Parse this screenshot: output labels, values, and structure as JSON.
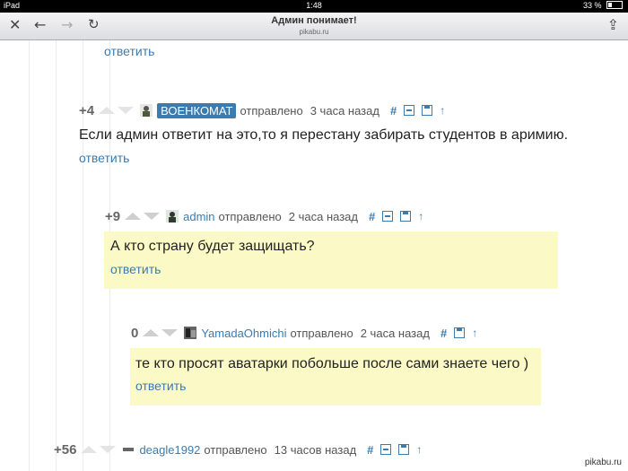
{
  "status": {
    "device": "iPad",
    "time": "1:48",
    "battery": "33 %"
  },
  "browser": {
    "title": "Админ понимает!",
    "url": "pikabu.ru"
  },
  "reply_label": "ответить",
  "comments": [
    {
      "score": "+4",
      "user": "ВОЕНКОМАТ",
      "sent": "отправлено",
      "when": "3 часа назад",
      "text": "Если админ ответит на это,то я перестану забирать студентов в аримию."
    },
    {
      "score": "+9",
      "user": "admin",
      "sent": "отправлено",
      "when": "2 часа назад",
      "text": "А кто страну будет защищать?"
    },
    {
      "score": "0",
      "user": "YamadaOhmichi",
      "sent": "отправлено",
      "when": "2 часа назад",
      "text": "те кто просят аватарки побольше после сами знаете чего )"
    },
    {
      "score": "+56",
      "user": "deagle1992",
      "sent": "отправлено",
      "when": "13 часов назад",
      "text": ""
    }
  ],
  "watermark": "pikabu.ru"
}
